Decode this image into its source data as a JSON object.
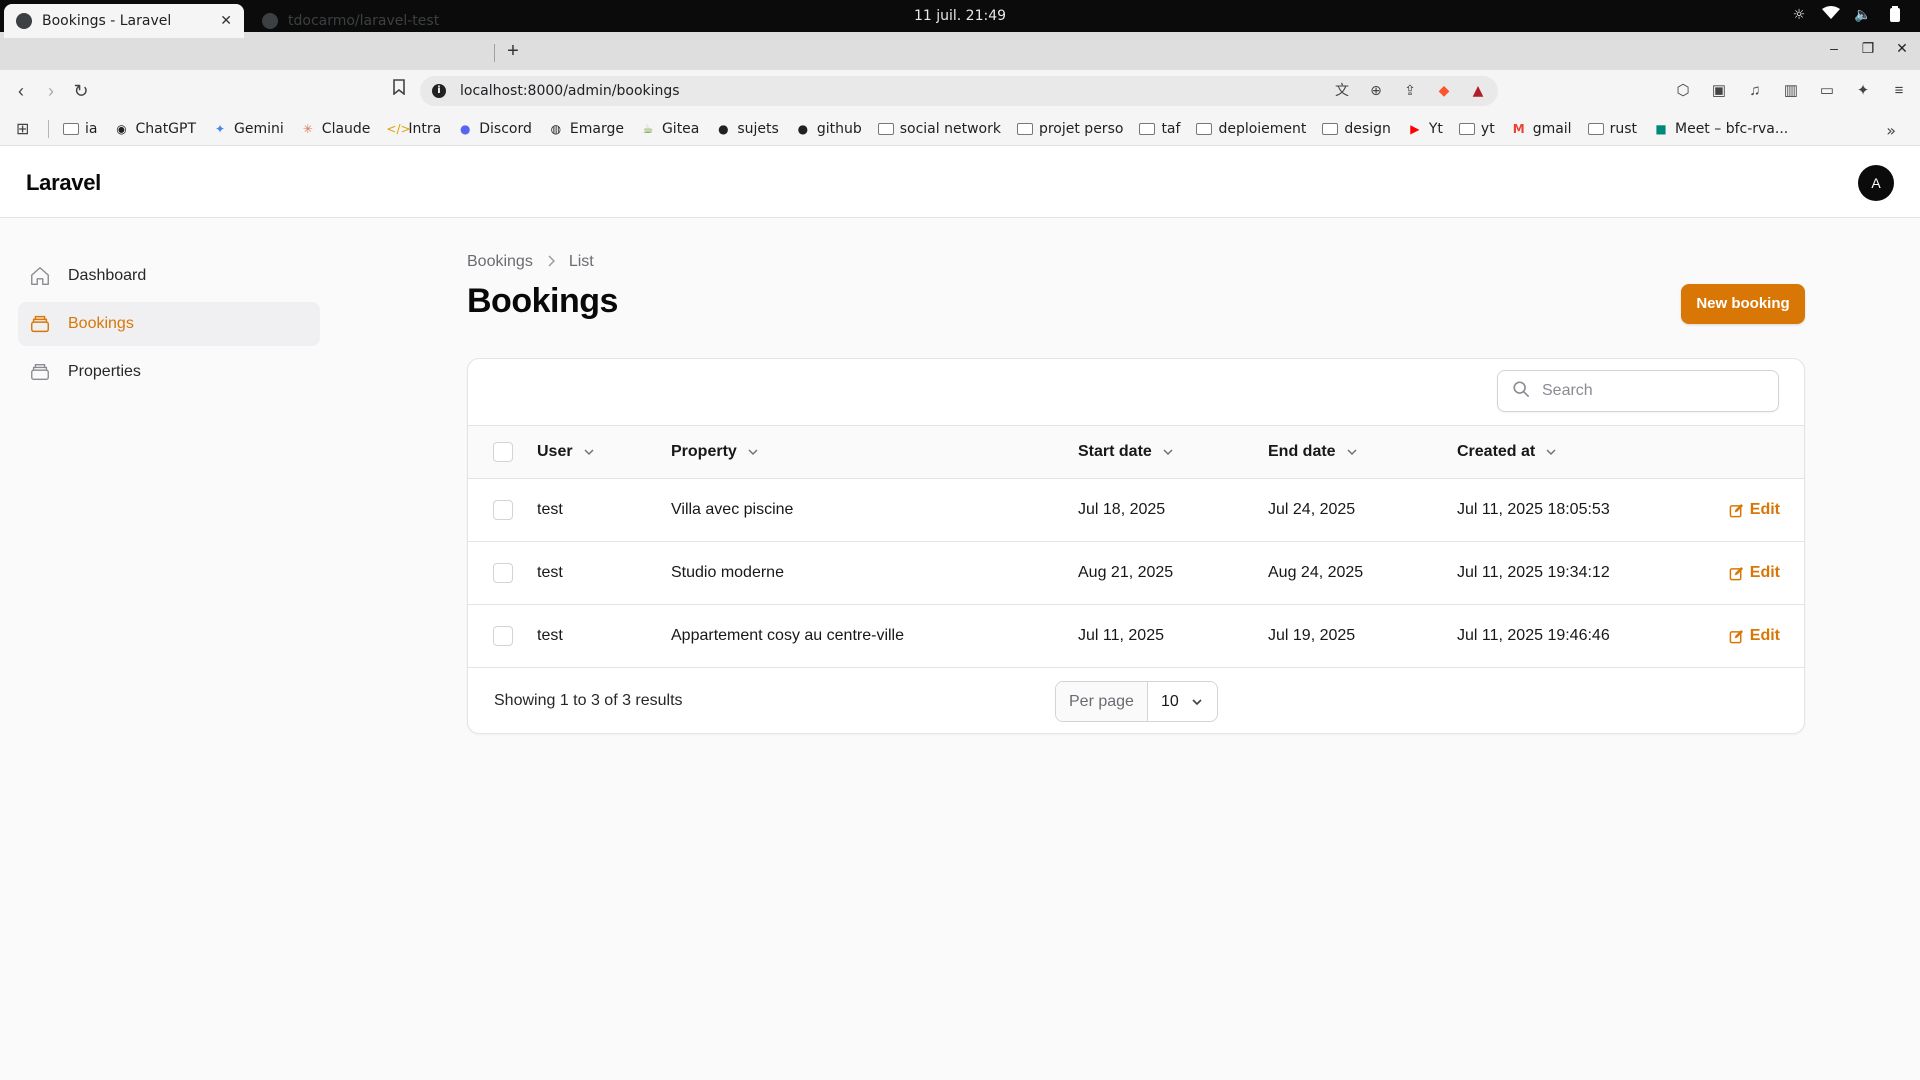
{
  "os": {
    "datetime": "11 juil.  21:49"
  },
  "browser": {
    "tabs": [
      {
        "title": "Bookings - Laravel",
        "active": true
      },
      {
        "title": "tdocarmo/laravel-test",
        "active": false
      }
    ],
    "url": "localhost:8000/admin/bookings",
    "bookmarks": [
      {
        "label": "ia",
        "icon": "folder-icon"
      },
      {
        "label": "ChatGPT",
        "icon": "chatgpt-icon"
      },
      {
        "label": "Gemini",
        "icon": "gemini-icon"
      },
      {
        "label": "Claude",
        "icon": "claude-icon"
      },
      {
        "label": "Intra",
        "icon": "code-icon"
      },
      {
        "label": "Discord",
        "icon": "discord-icon"
      },
      {
        "label": "Emarge",
        "icon": "globe-icon"
      },
      {
        "label": "Gitea",
        "icon": "gitea-icon"
      },
      {
        "label": "sujets",
        "icon": "github-icon"
      },
      {
        "label": "github",
        "icon": "github-icon"
      },
      {
        "label": "social network",
        "icon": "folder-icon"
      },
      {
        "label": "projet perso",
        "icon": "folder-icon"
      },
      {
        "label": "taf",
        "icon": "folder-icon"
      },
      {
        "label": "deploiement",
        "icon": "folder-icon"
      },
      {
        "label": "design",
        "icon": "folder-icon"
      },
      {
        "label": "Yt",
        "icon": "youtube-icon"
      },
      {
        "label": "yt",
        "icon": "folder-icon"
      },
      {
        "label": "gmail",
        "icon": "gmail-icon"
      },
      {
        "label": "rust",
        "icon": "folder-icon"
      },
      {
        "label": "Meet – bfc-rva...",
        "icon": "meet-icon"
      }
    ]
  },
  "app": {
    "brand": "Laravel",
    "avatar_initial": "A",
    "accent_color": "#d97706"
  },
  "sidebar": {
    "items": [
      {
        "label": "Dashboard",
        "active": false
      },
      {
        "label": "Bookings",
        "active": true
      },
      {
        "label": "Properties",
        "active": false
      }
    ]
  },
  "page": {
    "breadcrumb": [
      "Bookings",
      "List"
    ],
    "title": "Bookings",
    "new_button": "New booking"
  },
  "table": {
    "search_placeholder": "Search",
    "columns": {
      "user": "User",
      "property": "Property",
      "start_date": "Start date",
      "end_date": "End date",
      "created_at": "Created at"
    },
    "rows": [
      {
        "user": "test",
        "property": "Villa avec piscine",
        "start_date": "Jul 18, 2025",
        "end_date": "Jul 24, 2025",
        "created_at": "Jul 11, 2025 18:05:53",
        "action": "Edit"
      },
      {
        "user": "test",
        "property": "Studio moderne",
        "start_date": "Aug 21, 2025",
        "end_date": "Aug 24, 2025",
        "created_at": "Jul 11, 2025 19:34:12",
        "action": "Edit"
      },
      {
        "user": "test",
        "property": "Appartement cosy au centre-ville",
        "start_date": "Jul 11, 2025",
        "end_date": "Jul 19, 2025",
        "created_at": "Jul 11, 2025 19:46:46",
        "action": "Edit"
      }
    ],
    "footer": {
      "showing": "Showing 1 to 3 of 3 results",
      "per_page_label": "Per page",
      "per_page_value": "10"
    }
  }
}
